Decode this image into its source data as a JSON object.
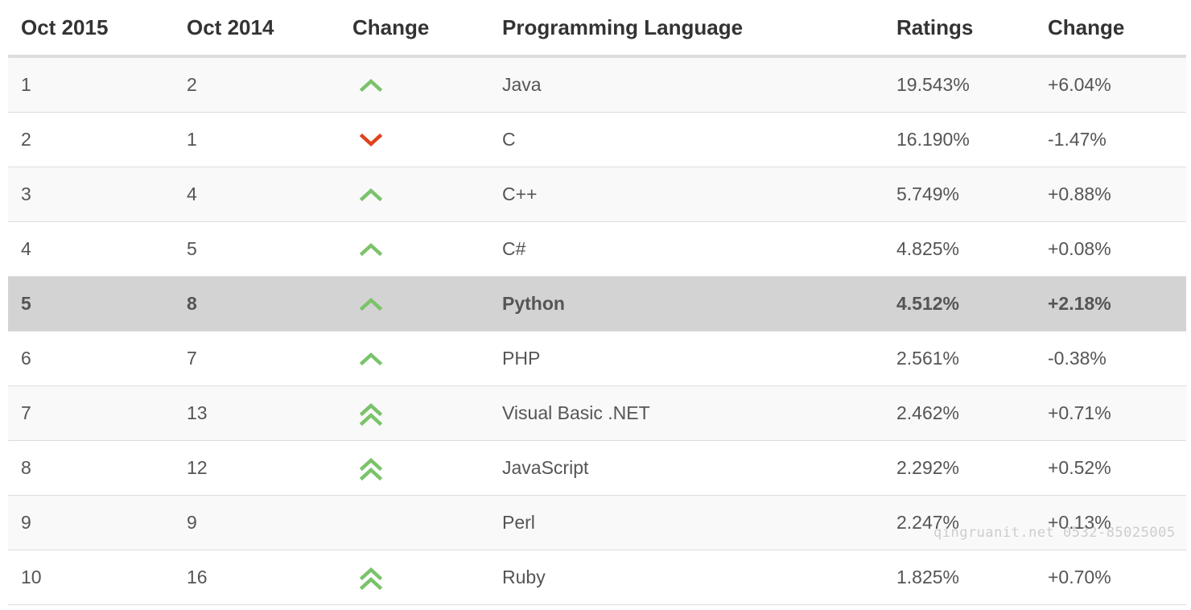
{
  "headers": [
    "Oct 2015",
    "Oct 2014",
    "Change",
    "Programming Language",
    "Ratings",
    "Change"
  ],
  "rows": [
    {
      "rank_now": "1",
      "rank_prev": "2",
      "trend": "up",
      "language": "Java",
      "rating": "19.543%",
      "change": "+6.04%",
      "highlighted": false
    },
    {
      "rank_now": "2",
      "rank_prev": "1",
      "trend": "down",
      "language": "C",
      "rating": "16.190%",
      "change": "-1.47%",
      "highlighted": false
    },
    {
      "rank_now": "3",
      "rank_prev": "4",
      "trend": "up",
      "language": "C++",
      "rating": "5.749%",
      "change": "+0.88%",
      "highlighted": false
    },
    {
      "rank_now": "4",
      "rank_prev": "5",
      "trend": "up",
      "language": "C#",
      "rating": "4.825%",
      "change": "+0.08%",
      "highlighted": false
    },
    {
      "rank_now": "5",
      "rank_prev": "8",
      "trend": "up",
      "language": "Python",
      "rating": "4.512%",
      "change": "+2.18%",
      "highlighted": true
    },
    {
      "rank_now": "6",
      "rank_prev": "7",
      "trend": "up",
      "language": "PHP",
      "rating": "2.561%",
      "change": "-0.38%",
      "highlighted": false
    },
    {
      "rank_now": "7",
      "rank_prev": "13",
      "trend": "double-up",
      "language": "Visual Basic .NET",
      "rating": "2.462%",
      "change": "+0.71%",
      "highlighted": false
    },
    {
      "rank_now": "8",
      "rank_prev": "12",
      "trend": "double-up",
      "language": "JavaScript",
      "rating": "2.292%",
      "change": "+0.52%",
      "highlighted": false
    },
    {
      "rank_now": "9",
      "rank_prev": "9",
      "trend": "none",
      "language": "Perl",
      "rating": "2.247%",
      "change": "+0.13%",
      "highlighted": false
    },
    {
      "rank_now": "10",
      "rank_prev": "16",
      "trend": "double-up",
      "language": "Ruby",
      "rating": "1.825%",
      "change": "+0.70%",
      "highlighted": false
    }
  ],
  "icons": {
    "up": "chevron-up-icon",
    "double-up": "double-chevron-up-icon",
    "down": "chevron-down-icon"
  },
  "colors": {
    "up": "#7ac36a",
    "down": "#e0421c",
    "highlight_row": "#d3d3d3"
  },
  "watermark": "qingruanit.net 0532-85025005"
}
